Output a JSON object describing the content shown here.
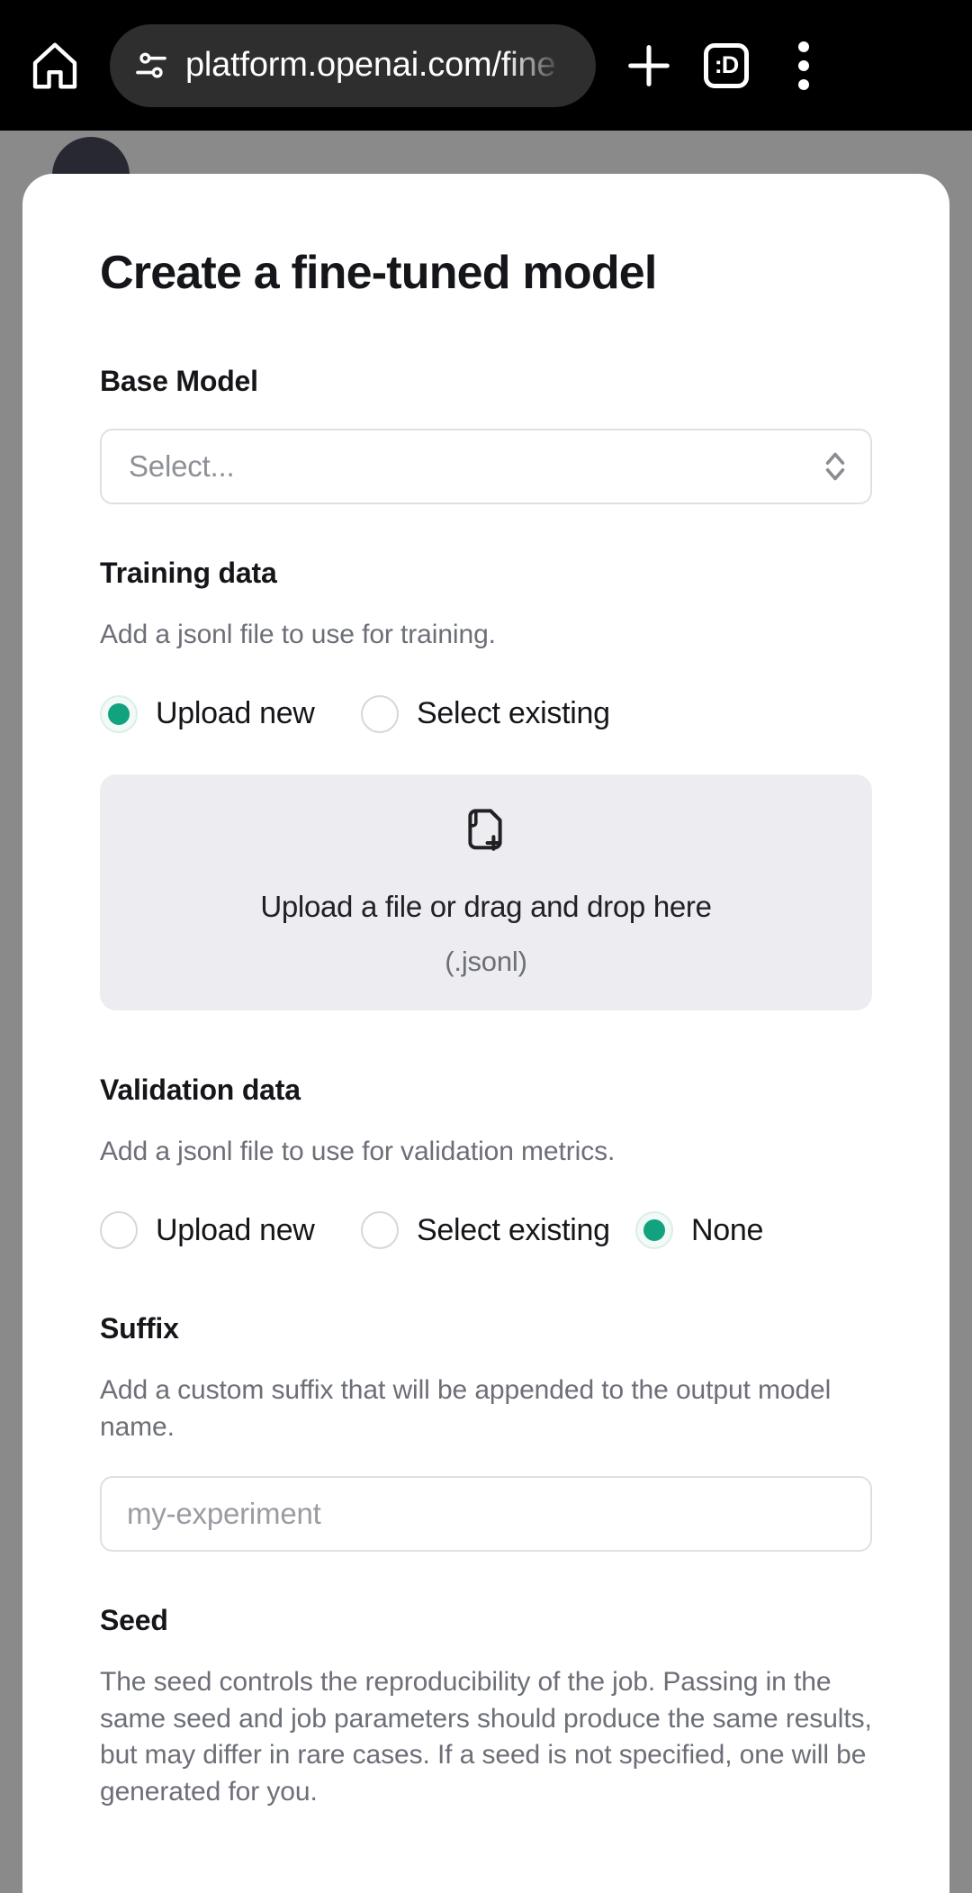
{
  "browser": {
    "home_icon": "home-icon",
    "tune_icon": "tune-icon",
    "url": "platform.openai.com/fine",
    "new_tab_label": "+",
    "tab_count": ":D",
    "menu_icon": "kebab-menu-icon"
  },
  "modal": {
    "title": "Create a fine-tuned model",
    "base_model": {
      "label": "Base Model",
      "placeholder": "Select...",
      "value": "Select...",
      "chevron_icon": "chevron-up-down-icon"
    },
    "training_data": {
      "label": "Training data",
      "description": "Add a jsonl file to use for training.",
      "options": [
        {
          "label": "Upload new",
          "selected": true
        },
        {
          "label": "Select existing",
          "selected": false
        }
      ],
      "dropzone": {
        "icon": "file-plus-icon",
        "main_text": "Upload a file or drag and drop here",
        "sub_text": "(.jsonl)"
      }
    },
    "validation_data": {
      "label": "Validation data",
      "description": "Add a jsonl file to use for validation metrics.",
      "options": [
        {
          "label": "Upload new",
          "selected": false
        },
        {
          "label": "Select existing",
          "selected": false
        },
        {
          "label": "None",
          "selected": true
        }
      ]
    },
    "suffix": {
      "label": "Suffix",
      "description": "Add a custom suffix that will be appended to the output model name.",
      "placeholder": "my-experiment",
      "value": ""
    },
    "seed": {
      "label": "Seed",
      "description": "The seed controls the reproducibility of the job. Passing in the same seed and job parameters should produce the same results, but may differ in rare cases. If a seed is not specified, one will be generated for you."
    }
  },
  "colors": {
    "accent_green": "#12a37e",
    "dropzone_bg": "#ececf1",
    "overlay": "#8a8a8a",
    "chrome_bg": "#000000",
    "url_pill": "#2e2e2e"
  }
}
